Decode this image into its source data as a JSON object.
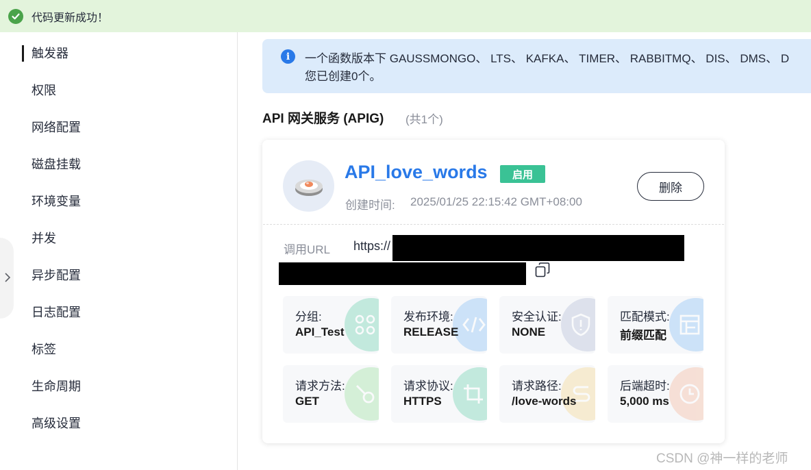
{
  "notification": {
    "text": "代码更新成功！",
    "color": "#4aa34a"
  },
  "sidebar": {
    "items": [
      {
        "label": "触发器",
        "active": true
      },
      {
        "label": "权限"
      },
      {
        "label": "网络配置"
      },
      {
        "label": "磁盘挂载"
      },
      {
        "label": "环境变量"
      },
      {
        "label": "并发"
      },
      {
        "label": "异步配置"
      },
      {
        "label": "日志配置"
      },
      {
        "label": "标签"
      },
      {
        "label": "生命周期"
      },
      {
        "label": "高级设置"
      }
    ]
  },
  "info": {
    "line1": "一个函数版本下 GAUSSMONGO、 LTS、 KAFKA、 TIMER、 RABBITMQ、 DIS、 DMS、 D",
    "line2": "您已创建0个。"
  },
  "section": {
    "title": "API 网关服务 (APIG)",
    "count": "(共1个)"
  },
  "trigger": {
    "name": "API_love_words",
    "status": "启用",
    "created_label": "创建时间:",
    "created_value": "2025/01/25 22:15:42 GMT+08:00",
    "delete_label": "删除",
    "url_label": "调用URL",
    "url_value": "https://"
  },
  "details": [
    {
      "label": "分组:",
      "value": "API_Test",
      "icon": "grid-icon",
      "color": "#3ac295"
    },
    {
      "label": "发布环境:",
      "value": "RELEASE",
      "icon": "code-icon",
      "color": "#5ea9f2"
    },
    {
      "label": "安全认证:",
      "value": "NONE",
      "icon": "shield-icon",
      "color": "#9aa6c8"
    },
    {
      "label": "匹配模式:",
      "value": "前缀匹配",
      "icon": "layout-icon",
      "color": "#5ea9f2"
    },
    {
      "label": "请求方法:",
      "value": "GET",
      "icon": "method-icon",
      "color": "#7bd67e"
    },
    {
      "label": "请求协议:",
      "value": "HTTPS",
      "icon": "crop-icon",
      "color": "#3ac295"
    },
    {
      "label": "请求路径:",
      "value": "/love-words",
      "icon": "path-icon",
      "color": "#f5c96a"
    },
    {
      "label": "后端超时:",
      "value": "5,000 ms",
      "icon": "clock-icon",
      "color": "#f5a07a"
    }
  ],
  "watermark": "CSDN @神一样的老师"
}
